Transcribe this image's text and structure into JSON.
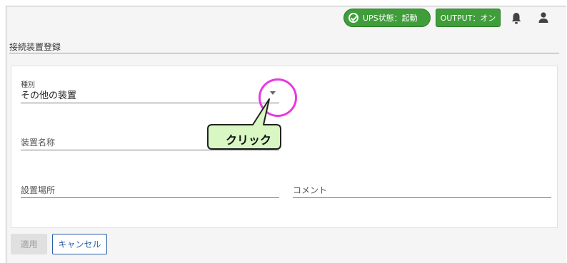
{
  "header": {
    "ups_status": "UPS状態：起動",
    "output_status": "OUTPUT：オン",
    "icons": [
      "bell-icon",
      "person-icon",
      "check-circle-icon"
    ]
  },
  "page": {
    "title": "接続装置登録"
  },
  "form": {
    "type_label": "種別",
    "type_value": "その他の装置",
    "device_name_placeholder": "装置名称",
    "location_placeholder": "設置場所",
    "comment_placeholder": "コメント"
  },
  "buttons": {
    "apply": "適用",
    "cancel": "キャンセル"
  },
  "annotation": {
    "callout": "クリック"
  },
  "colors": {
    "accent_green": "#3f9d3a",
    "cancel_blue": "#2a5da8",
    "highlight_magenta": "#e839e0",
    "callout_green": "#d9f7c3"
  }
}
